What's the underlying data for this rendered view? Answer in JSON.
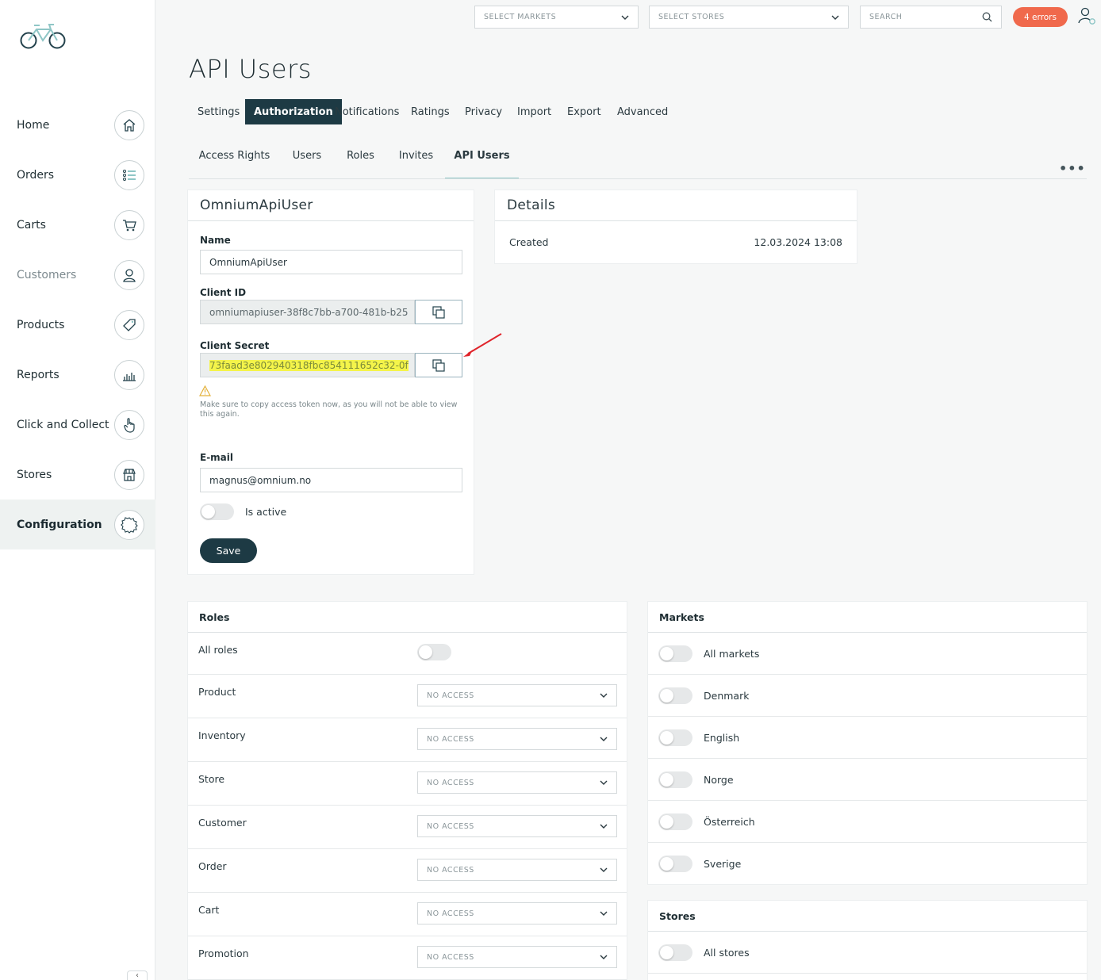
{
  "sidebar": {
    "items": [
      {
        "label": "Home",
        "icon": "home-icon"
      },
      {
        "label": "Orders",
        "icon": "list-icon"
      },
      {
        "label": "Carts",
        "icon": "cart-icon"
      },
      {
        "label": "Customers",
        "icon": "user-icon"
      },
      {
        "label": "Products",
        "icon": "tag-icon"
      },
      {
        "label": "Reports",
        "icon": "bar-chart-icon"
      },
      {
        "label": "Click and Collect",
        "icon": "hand-pointer-icon"
      },
      {
        "label": "Stores",
        "icon": "store-icon"
      },
      {
        "label": "Configuration",
        "icon": "gear-icon"
      }
    ],
    "collapse_label": "‹"
  },
  "topbar": {
    "markets_placeholder": "SELECT MARKETS",
    "stores_placeholder": "SELECT STORES",
    "search_placeholder": "SEARCH",
    "errors_label": "4 errors"
  },
  "page": {
    "title": "API Users",
    "tabs": [
      "Settings",
      "Authorization",
      "Notifications",
      "Ratings",
      "Privacy",
      "Import",
      "Export",
      "Advanced"
    ],
    "subtabs": [
      "Access Rights",
      "Users",
      "Roles",
      "Invites",
      "API Users"
    ],
    "more_label": "•••"
  },
  "user_card": {
    "title": "OmniumApiUser",
    "name_label": "Name",
    "name_value": "OmniumApiUser",
    "client_id_label": "Client ID",
    "client_id_value": "omniumapiuser-38f8c7bb-a700-481b-b25",
    "client_secret_label": "Client Secret",
    "client_secret_value": "73faad3e802940318fbc854111652c32-0f",
    "warning_text": "Make sure to copy access token now, as you will not be able to view this again.",
    "email_label": "E-mail",
    "email_value": "magnus@omnium.no",
    "is_active_label": "Is active",
    "save_label": "Save"
  },
  "details": {
    "title": "Details",
    "created_label": "Created",
    "created_value": "12.03.2024 13:08"
  },
  "roles": {
    "title": "Roles",
    "all_roles_label": "All roles",
    "rows": [
      {
        "label": "Product",
        "value": "NO ACCESS"
      },
      {
        "label": "Inventory",
        "value": "NO ACCESS"
      },
      {
        "label": "Store",
        "value": "NO ACCESS"
      },
      {
        "label": "Customer",
        "value": "NO ACCESS"
      },
      {
        "label": "Order",
        "value": "NO ACCESS"
      },
      {
        "label": "Cart",
        "value": "NO ACCESS"
      },
      {
        "label": "Promotion",
        "value": "NO ACCESS"
      }
    ]
  },
  "markets": {
    "title": "Markets",
    "rows": [
      "All markets",
      "Denmark",
      "English",
      "Norge",
      "Österreich",
      "Sverige"
    ]
  },
  "stores": {
    "title": "Stores",
    "rows": [
      "All stores"
    ]
  },
  "colors": {
    "primary": "#1d3a44",
    "error": "#f0694c",
    "highlight": "#f4f44a",
    "annotation_arrow": "#e0242b"
  }
}
